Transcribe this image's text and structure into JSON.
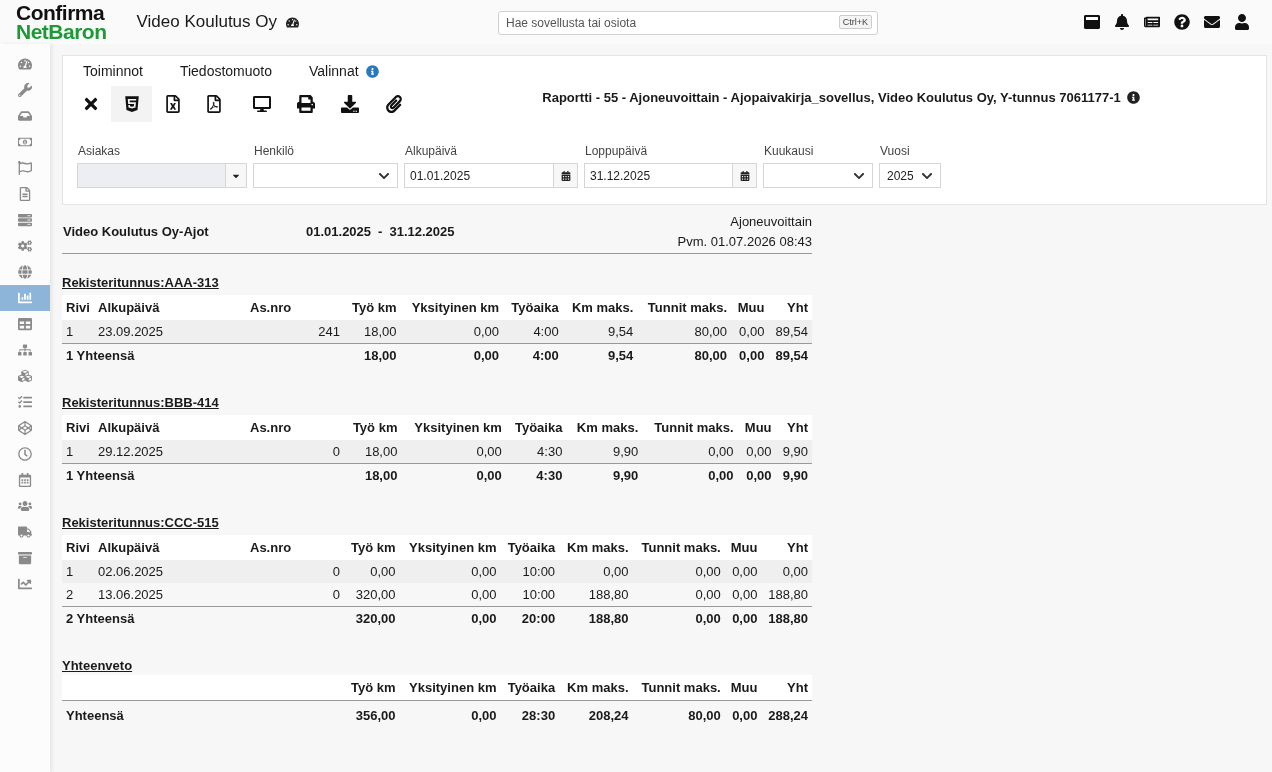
{
  "header": {
    "logo": {
      "line_1": "Confirma",
      "line_2": "NetBaron"
    },
    "company": "Video Koulutus Oy",
    "search": {
      "placeholder": "Hae sovellusta tai osiota",
      "shortcut": "Ctrl+K"
    }
  },
  "sidebar": {
    "items": [
      {
        "selected": false
      },
      {
        "selected": false
      },
      {
        "selected": false
      },
      {
        "selected": false
      },
      {
        "selected": false
      },
      {
        "selected": false
      },
      {
        "selected": false
      },
      {
        "selected": false
      },
      {
        "selected": false
      },
      {
        "selected": true
      },
      {
        "selected": false
      },
      {
        "selected": false
      },
      {
        "selected": false
      },
      {
        "selected": false
      },
      {
        "selected": false
      },
      {
        "selected": false
      },
      {
        "selected": false
      },
      {
        "selected": false
      },
      {
        "selected": false
      },
      {
        "selected": false
      },
      {
        "selected": false
      }
    ]
  },
  "toolbar": {
    "menus": [
      {
        "label": "Toiminnot",
        "info_icon": false
      },
      {
        "label": "Tiedostomuoto",
        "info_icon": false
      },
      {
        "label": "Valinnat",
        "info_icon": true
      }
    ],
    "buttons": [
      {
        "selected": false
      },
      {
        "selected": true
      },
      {
        "selected": false
      },
      {
        "selected": false
      },
      {
        "selected": false
      },
      {
        "selected": false
      },
      {
        "selected": false
      },
      {
        "selected": false
      }
    ],
    "report_title": "Raportti - 55 - Ajoneuvoittain - Ajopaivakirja_sovellus, Video Koulutus Oy, Y-tunnus 7061177-1"
  },
  "filters": [
    {
      "label": "Asiakas",
      "kind": "combo",
      "disabled": true
    },
    {
      "label": "Henkilö",
      "kind": "select",
      "disabled": false
    },
    {
      "label": "Alkupäivä",
      "kind": "date",
      "value": "01.01.2025",
      "disabled": false
    },
    {
      "label": "Loppupäivä",
      "kind": "date",
      "value": "31.12.2025",
      "disabled": false
    },
    {
      "label": "Kuukausi",
      "kind": "select",
      "disabled": false
    },
    {
      "label": "Vuosi",
      "kind": "select",
      "value": "2025",
      "disabled": false
    }
  ],
  "report": {
    "title": "Video Koulutus Oy-Ajot",
    "period_start": "01.01.2025",
    "period_separator": "-",
    "period_end": "31.12.2025",
    "report_type": "Ajoneuvoittain",
    "printed": "Pvm. 01.07.2026 08:43",
    "sections": [
      {
        "title": "Rekisteritunnus:AAA-313",
        "columns": [
          "Rivi",
          "Alkupäivä",
          "As.nro",
          "Työ km",
          "Yksityinen km",
          "Työaika",
          "Km maks.",
          "Tunnit maks.",
          "Muu",
          "Yht"
        ],
        "rows": [
          [
            "1",
            "23.09.2025",
            "241",
            "18,00",
            "0,00",
            "4:00",
            "9,54",
            "80,00",
            "0,00",
            "89,54"
          ]
        ],
        "total": {
          "label": "1 Yhteensä",
          "values": [
            "18,00",
            "0,00",
            "4:00",
            "9,54",
            "80,00",
            "0,00",
            "89,54"
          ]
        }
      },
      {
        "title": "Rekisteritunnus:BBB-414",
        "columns": [
          "Rivi",
          "Alkupäivä",
          "As.nro",
          "Työ km",
          "Yksityinen km",
          "Työaika",
          "Km maks.",
          "Tunnit maks.",
          "Muu",
          "Yht"
        ],
        "rows": [
          [
            "1",
            "29.12.2025",
            "0",
            "18,00",
            "0,00",
            "4:30",
            "9,90",
            "0,00",
            "0,00",
            "9,90"
          ]
        ],
        "total": {
          "label": "1 Yhteensä",
          "values": [
            "18,00",
            "0,00",
            "4:30",
            "9,90",
            "0,00",
            "0,00",
            "9,90"
          ]
        }
      },
      {
        "title": "Rekisteritunnus:CCC-515",
        "columns": [
          "Rivi",
          "Alkupäivä",
          "As.nro",
          "Työ km",
          "Yksityinen km",
          "Työaika",
          "Km maks.",
          "Tunnit maks.",
          "Muu",
          "Yht"
        ],
        "rows": [
          [
            "1",
            "02.06.2025",
            "0",
            "0,00",
            "0,00",
            "10:00",
            "0,00",
            "0,00",
            "0,00",
            "0,00"
          ],
          [
            "2",
            "13.06.2025",
            "0",
            "320,00",
            "0,00",
            "10:00",
            "188,80",
            "0,00",
            "0,00",
            "188,80"
          ]
        ],
        "total": {
          "label": "2 Yhteensä",
          "values": [
            "320,00",
            "0,00",
            "20:00",
            "188,80",
            "0,00",
            "0,00",
            "188,80"
          ]
        }
      }
    ],
    "summary": {
      "title": "Yhteenveto",
      "columns": [
        "Työ km",
        "Yksityinen km",
        "Työaika",
        "Km maks.",
        "Tunnit maks.",
        "Muu",
        "Yht"
      ],
      "total": {
        "label": "Yhteensä",
        "values": [
          "356,00",
          "0,00",
          "28:30",
          "208,24",
          "80,00",
          "0,00",
          "288,24"
        ]
      }
    }
  }
}
